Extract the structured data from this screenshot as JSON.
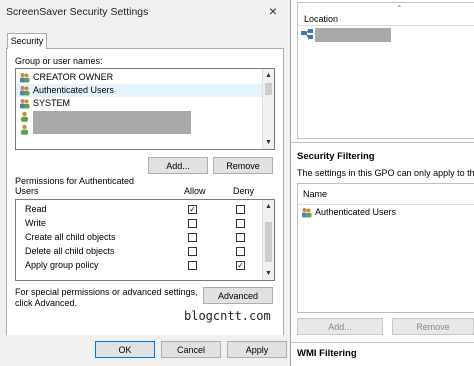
{
  "dialog": {
    "title": "ScreenSaver Security Settings",
    "close_glyph": "×",
    "tab_label": "Security",
    "group_label": "Group or user names:",
    "users": [
      {
        "name": "CREATOR OWNER",
        "selected": false
      },
      {
        "name": "Authenticated Users",
        "selected": true
      },
      {
        "name": "SYSTEM",
        "selected": false
      },
      {
        "name": "",
        "selected": false
      },
      {
        "name": "",
        "selected": false
      }
    ],
    "add_button": "Add...",
    "remove_button": "Remove",
    "permissions_label_line1": "Permissions for Authenticated",
    "permissions_label_line2": "Users",
    "allow_header": "Allow",
    "deny_header": "Deny",
    "permissions": [
      {
        "name": "Read",
        "allow": true,
        "deny": false
      },
      {
        "name": "Write",
        "allow": false,
        "deny": false
      },
      {
        "name": "Create all child objects",
        "allow": false,
        "deny": false
      },
      {
        "name": "Delete all child objects",
        "allow": false,
        "deny": false
      },
      {
        "name": "Apply group policy",
        "allow": false,
        "deny": true
      }
    ],
    "special_line1": "For special permissions or advanced settings,",
    "special_line2": "click Advanced.",
    "advanced_button": "Advanced",
    "ok_button": "OK",
    "cancel_button": "Cancel",
    "apply_button": "Apply",
    "watermark": "blogcntt.com"
  },
  "gpo": {
    "location_header": "Location",
    "security_filtering_title": "Security Filtering",
    "security_filtering_desc": "The settings in this GPO can only apply to the f",
    "name_header": "Name",
    "filter_items": [
      "Authenticated Users"
    ],
    "add_button": "Add...",
    "remove_button": "Remove",
    "wmi_title": "WMI Filtering"
  },
  "colors": {
    "dialog_bg": "#f0f0f0",
    "selection": "#e5f3ff",
    "default_button_border": "#0078d7",
    "redaction": "#a9a9a9"
  }
}
